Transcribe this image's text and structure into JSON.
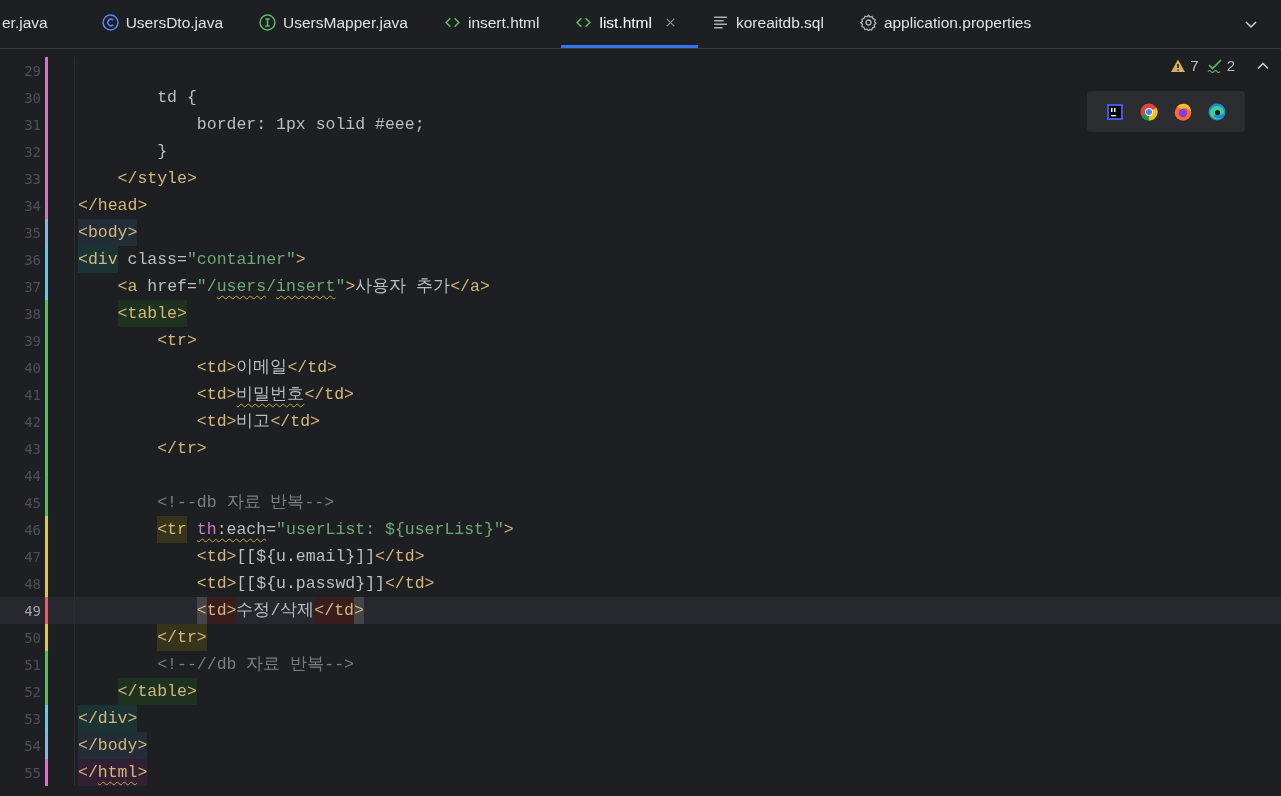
{
  "tabs": [
    {
      "label": "er.java",
      "kind": "none",
      "selected": false
    },
    {
      "label": "UsersDto.java",
      "kind": "class",
      "selected": false
    },
    {
      "label": "UsersMapper.java",
      "kind": "interface",
      "selected": false
    },
    {
      "label": "insert.html",
      "kind": "html",
      "selected": false
    },
    {
      "label": "list.html",
      "kind": "html",
      "selected": true
    },
    {
      "label": "koreaitdb.sql",
      "kind": "text",
      "selected": false
    },
    {
      "label": "application.properties",
      "kind": "settings",
      "selected": false
    }
  ],
  "inspections": {
    "warnings": "7",
    "weak_warnings": "2"
  },
  "lines": [
    {
      "number": "29",
      "color": "#c77dbb",
      "current": false
    },
    {
      "number": "30",
      "color": "#c77dbb",
      "current": false,
      "tokens": [
        {
          "kind": "css",
          "text": "        td {"
        }
      ]
    },
    {
      "number": "31",
      "color": "#c77dbb",
      "current": false,
      "tokens": [
        {
          "kind": "css",
          "text": "            border: 1px solid #eee;"
        }
      ]
    },
    {
      "number": "32",
      "color": "#c77dbb",
      "current": false,
      "tokens": [
        {
          "kind": "css",
          "text": "        }"
        }
      ]
    },
    {
      "number": "33",
      "color": "#c77dbb",
      "current": false,
      "tokens": [
        {
          "kind": "tag",
          "text": "    </style>"
        }
      ]
    },
    {
      "number": "34",
      "color": "#c77dbb",
      "current": false,
      "tokens": [
        {
          "kind": "tag",
          "text": "</head>"
        }
      ]
    },
    {
      "number": "35",
      "color": "#8fb3d9",
      "current": false,
      "tokens": [
        {
          "kind": "tag",
          "text": "<body>",
          "color": "#232d38"
        }
      ]
    },
    {
      "number": "36",
      "color": "#6ec6e0",
      "current": false,
      "tokens": [
        {
          "kind": "tag",
          "text": "<div",
          "color": "#1a3334"
        },
        {
          "kind": "attr",
          "text": " class="
        },
        {
          "kind": "str",
          "text": "\"container\""
        },
        {
          "kind": "tag",
          "text": ">"
        }
      ]
    },
    {
      "number": "37",
      "color": "#6ec6e0",
      "current": false,
      "tokens": [
        {
          "kind": "tag",
          "text": "    <a"
        },
        {
          "kind": "attr",
          "text": " href="
        },
        {
          "kind": "str",
          "text": "\"/"
        },
        {
          "kind": "str",
          "text": "users",
          "squiggle": true
        },
        {
          "kind": "str",
          "text": "/"
        },
        {
          "kind": "str",
          "text": "insert",
          "squiggle": true
        },
        {
          "kind": "str",
          "text": "\""
        },
        {
          "kind": "tag",
          "text": ">"
        },
        {
          "kind": "text",
          "text": "사용자 추가"
        },
        {
          "kind": "tag",
          "text": "</a>"
        }
      ]
    },
    {
      "number": "38",
      "color": "#5fb865",
      "current": false,
      "tokens": [
        {
          "kind": "tag",
          "text": "    <table>",
          "color": "#1d3320"
        }
      ]
    },
    {
      "number": "39",
      "color": "#5fb865",
      "current": false,
      "tokens": [
        {
          "kind": "tag",
          "text": "        <tr>"
        }
      ]
    },
    {
      "number": "40",
      "color": "#5fb865",
      "current": false,
      "tokens": [
        {
          "kind": "tag",
          "text": "            <td>"
        },
        {
          "kind": "text",
          "text": "이메일"
        },
        {
          "kind": "tag",
          "text": "</td>"
        }
      ]
    },
    {
      "number": "41",
      "color": "#5fb865",
      "current": false,
      "tokens": [
        {
          "kind": "tag",
          "text": "            <td>"
        },
        {
          "kind": "text",
          "text": "비밀번호",
          "squiggle": true
        },
        {
          "kind": "tag",
          "text": "</td>"
        }
      ]
    },
    {
      "number": "42",
      "color": "#5fb865",
      "current": false,
      "tokens": [
        {
          "kind": "tag",
          "text": "            <td>"
        },
        {
          "kind": "text",
          "text": "비고"
        },
        {
          "kind": "tag",
          "text": "</td>"
        }
      ]
    },
    {
      "number": "43",
      "color": "#5fb865",
      "current": false,
      "tokens": [
        {
          "kind": "tag",
          "text": "        </tr>"
        }
      ]
    },
    {
      "number": "44",
      "color": "#5fb865",
      "current": false
    },
    {
      "number": "45",
      "color": "#5fb865",
      "current": false,
      "tokens": [
        {
          "kind": "comment",
          "text": "        <!--db 자료 반복-->"
        }
      ]
    },
    {
      "number": "46",
      "color": "#d6c95a",
      "current": false,
      "tokens": [
        {
          "kind": "tag",
          "text": "        <tr",
          "color": "#36351c"
        },
        {
          "kind": "ns",
          "text": " th",
          "squiggle": true
        },
        {
          "kind": "attr",
          "text": ":each",
          "squiggle": true
        },
        {
          "kind": "attr",
          "text": "="
        },
        {
          "kind": "str",
          "text": "\"userList: ${userList}\""
        },
        {
          "kind": "tag",
          "text": ">"
        }
      ]
    },
    {
      "number": "47",
      "color": "#d6c95a",
      "current": false,
      "tokens": [
        {
          "kind": "tag",
          "text": "            <td>"
        },
        {
          "kind": "text",
          "text": "[[${u.email}]]"
        },
        {
          "kind": "tag",
          "text": "</td>"
        }
      ]
    },
    {
      "number": "48",
      "color": "#d6c95a",
      "current": false,
      "tokens": [
        {
          "kind": "tag",
          "text": "            <td>"
        },
        {
          "kind": "text",
          "text": "[[${u.passwd}]]"
        },
        {
          "kind": "tag",
          "text": "</td>"
        }
      ]
    },
    {
      "number": "49",
      "color": "#e0606a",
      "current": true,
      "tokens": [
        {
          "kind": "tag",
          "text": "            <",
          "color": "#43454a"
        },
        {
          "kind": "tag",
          "text": "td>",
          "color": "#3a1e1e"
        },
        {
          "kind": "text",
          "text": "수정/삭제"
        },
        {
          "kind": "tag",
          "text": "</td",
          "color": "#3a1e1e"
        },
        {
          "kind": "tag",
          "text": ">",
          "color": "#43454a"
        }
      ]
    },
    {
      "number": "50",
      "color": "#d6c95a",
      "current": false,
      "tokens": [
        {
          "kind": "tag",
          "text": "        </tr>",
          "color": "#36351c"
        }
      ]
    },
    {
      "number": "51",
      "color": "#5fb865",
      "current": false,
      "tokens": [
        {
          "kind": "comment",
          "text": "        <!--//db 자료 반복-->"
        }
      ]
    },
    {
      "number": "52",
      "color": "#5fb865",
      "current": false,
      "tokens": [
        {
          "kind": "tag",
          "text": "    </table>",
          "color": "#1d3320"
        }
      ]
    },
    {
      "number": "53",
      "color": "#6ec6e0",
      "current": false,
      "tokens": [
        {
          "kind": "tag",
          "text": "</div>",
          "color": "#1a3334"
        }
      ]
    },
    {
      "number": "54",
      "color": "#8fb3d9",
      "current": false,
      "tokens": [
        {
          "kind": "tag",
          "text": "</body>",
          "color": "#232d38"
        }
      ]
    },
    {
      "number": "55",
      "color": "#e070d0",
      "current": false,
      "tokens": [
        {
          "kind": "tag",
          "text": "</",
          "color": "#321f33"
        },
        {
          "kind": "tag",
          "text": "html",
          "color": "#321f33",
          "squiggle": true
        },
        {
          "kind": "tag",
          "text": ">",
          "color": "#321f33"
        }
      ]
    }
  ]
}
